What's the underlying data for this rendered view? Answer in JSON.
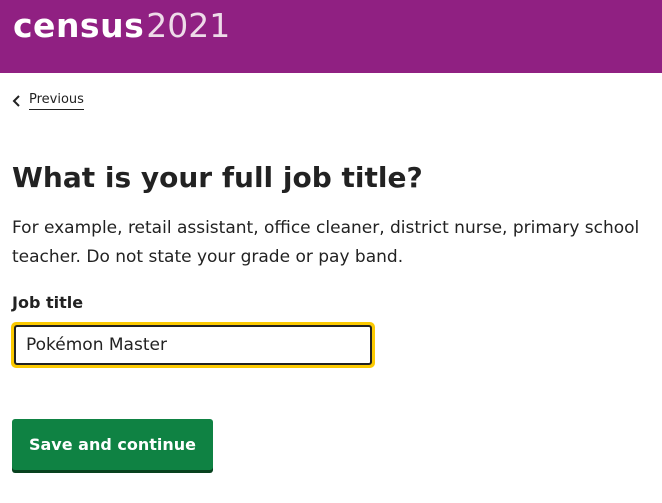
{
  "header": {
    "logo_word": "census",
    "logo_year": "2021",
    "background_color": "#902082"
  },
  "nav": {
    "back_label": "Previous",
    "back_icon": "chevron-left-icon"
  },
  "question": {
    "title": "What is your full job title?",
    "description": "For example, retail assistant, office cleaner, district nurse, primary school teacher. Do not state your grade or pay band.",
    "field_label": "Job title",
    "field_value": "Pokémon Master",
    "focus_color": "#fbc900"
  },
  "actions": {
    "submit_label": "Save and continue",
    "submit_color": "#0f8243"
  }
}
